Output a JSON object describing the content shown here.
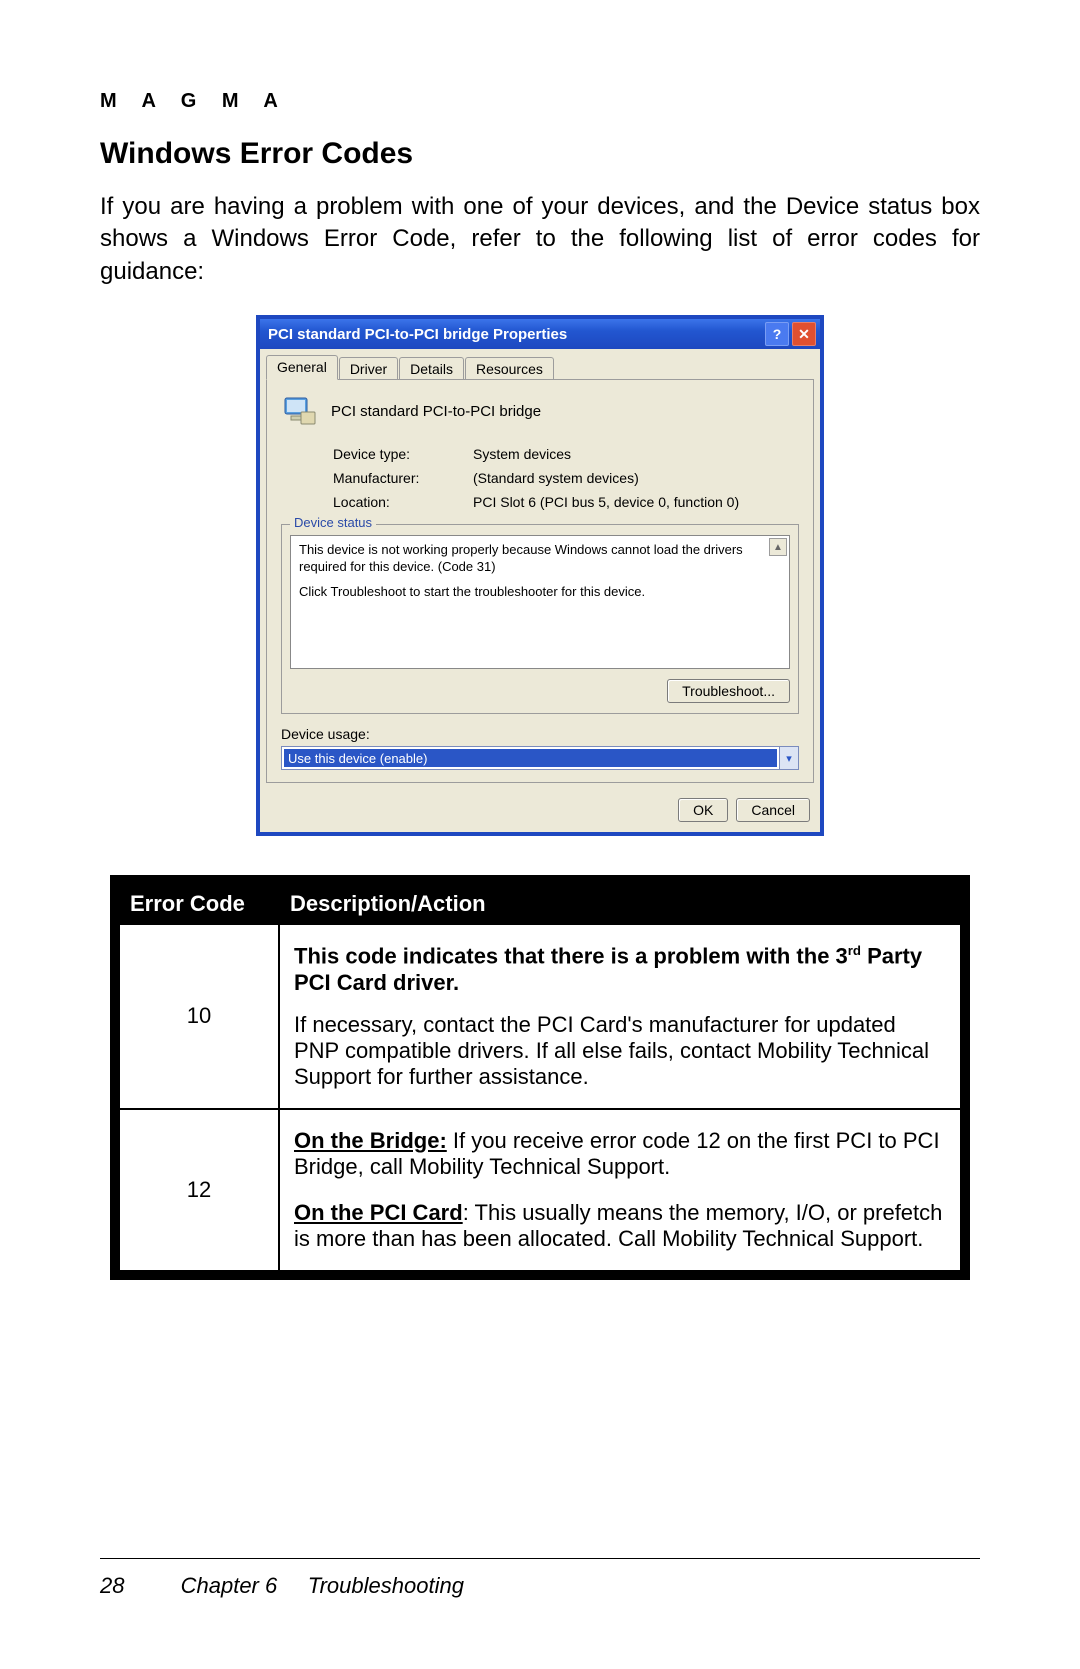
{
  "brand": "M A G M A",
  "heading": "Windows Error Codes",
  "intro": "If you are having a problem with one of your devices, and the Device status box shows a Windows Error Code, refer to the following list of error codes for guidance:",
  "dialog": {
    "title": "PCI standard PCI-to-PCI bridge Properties",
    "tabs": [
      "General",
      "Driver",
      "Details",
      "Resources"
    ],
    "device_name": "PCI standard PCI-to-PCI bridge",
    "labels": {
      "device_type": "Device type:",
      "manufacturer": "Manufacturer:",
      "location": "Location:"
    },
    "values": {
      "device_type": "System devices",
      "manufacturer": "(Standard system devices)",
      "location": "PCI Slot 6 (PCI bus 5, device 0, function 0)"
    },
    "status_label": "Device status",
    "status_line1": "This device is not working properly because Windows cannot load the drivers required for this device. (Code 31)",
    "status_line2": "Click Troubleshoot to start the troubleshooter for this device.",
    "troubleshoot_btn": "Troubleshoot...",
    "usage_label": "Device usage:",
    "usage_value": "Use this device (enable)",
    "ok": "OK",
    "cancel": "Cancel"
  },
  "table": {
    "headers": {
      "code": "Error Code",
      "desc": "Description/Action"
    },
    "rows": [
      {
        "code": "10",
        "bold_pre": "This code indicates that there is a problem with the 3",
        "bold_sup": "rd",
        "bold_post": " Party PCI Card driver.",
        "body": "If necessary, contact the PCI Card's manufacturer for updated PNP compatible drivers. If all else fails, contact Mobility Technical Support for further assistance."
      },
      {
        "code": "12",
        "p1_label": "On the Bridge:",
        "p1_rest": " If you receive error code 12 on the first PCI to PCI Bridge, call Mobility Technical Support.",
        "p2_label": "On the PCI Card",
        "p2_rest": ": This usually means the memory, I/O, or prefetch is more than has been allocated. Call Mobility Technical Support."
      }
    ]
  },
  "footer": {
    "page": "28",
    "chapter": "Chapter 6",
    "title": "Troubleshooting"
  }
}
